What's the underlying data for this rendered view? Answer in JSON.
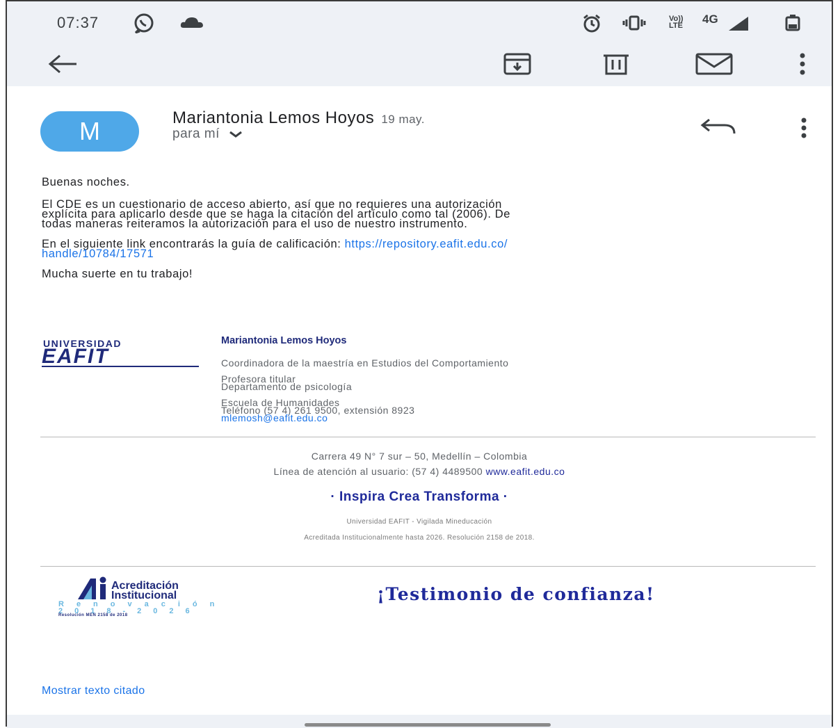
{
  "status": {
    "time": "07:37",
    "network": "4G",
    "volte": "Vo))\nLTE"
  },
  "toolbar": {
    "back": "back",
    "archive": "archive",
    "delete": "delete",
    "mark_unread": "mark unread",
    "more": "more"
  },
  "email": {
    "avatar_letter": "M",
    "sender": "Mariantonia Lemos Hoyos",
    "date": "19 may.",
    "to": "para mí",
    "greeting": "Buenas noches.",
    "p1_l1": "El CDE es un cuestionario de acceso abierto, así que no requieres una autorización",
    "p1_l2": "explícita para aplicarlo desde que se haga la citación del artículo como tal (2006). De",
    "p1_l3": "todas maneras reiteramos la autorización para el uso de nuestro instrumento.",
    "p2_text": "En el siguiente link encontrarás la guía de calificación: ",
    "p2_link_part1": "https://repository.eafit.edu.co/",
    "p2_link_part2": "handle/10784/17571",
    "closing": "Mucha suerte en tu trabajo!"
  },
  "signature": {
    "logo_top": "UNIVERSIDAD",
    "logo_main": "EAFIT",
    "name": "Mariantonia Lemos Hoyos",
    "role": "Coordinadora de la maestría en Estudios del Comportamiento",
    "title1": "Profesora titular",
    "title2": "Departamento de psicología",
    "school": "Escuela de Humanidades",
    "phone": "Teléfono (57 4) 261 9500, extensión 8923",
    "email": "mlemosh@eafit.edu.co"
  },
  "footer": {
    "address": "Carrera 49 N° 7 sur – 50, Medellín – Colombia",
    "line_text": "Línea de atención al usuario: (57 4) 4489500 ",
    "website": "www.eafit.edu.co",
    "motto": "· Inspira Crea Transforma ·",
    "vigilada": "Universidad EAFIT - Vigilada Mineducación",
    "acreditada": "Acreditada Institucionalmente hasta 2026. Resolución 2158 de 2018."
  },
  "banner": {
    "acred_line1": "Acreditación",
    "acred_line2": "Institucional",
    "renovacion": "Renovación",
    "years": "2018-2026",
    "resolucion": "Resolución MEN 2158 de 2018",
    "testimonio": "¡Testimonio de confianza!"
  },
  "show_quoted": "Mostrar texto citado"
}
